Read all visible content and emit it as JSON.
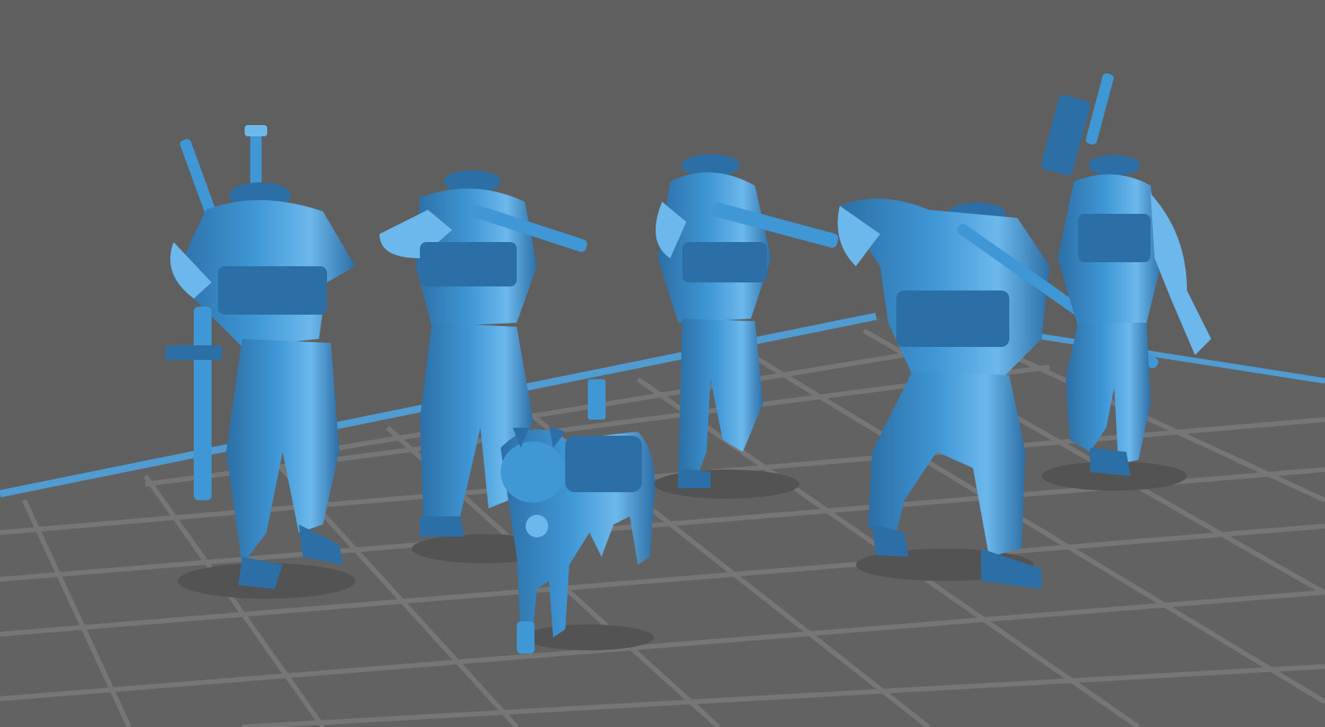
{
  "viewport": {
    "name": "3d-slicer-build-plate-view",
    "colors": {
      "background": "#5f5f5f",
      "floor": "#626262",
      "grid_line": "#767676",
      "plate_edge": "#4f9bd2",
      "model": "#3f97d6",
      "model_dark": "#2c6fa6",
      "model_light": "#6cb8ec",
      "shadow": "#505050"
    }
  },
  "models": [
    {
      "name": "soldier-figure-1"
    },
    {
      "name": "soldier-figure-2"
    },
    {
      "name": "dog-figure"
    },
    {
      "name": "soldier-figure-3"
    },
    {
      "name": "soldier-figure-4"
    },
    {
      "name": "soldier-figure-5"
    }
  ]
}
